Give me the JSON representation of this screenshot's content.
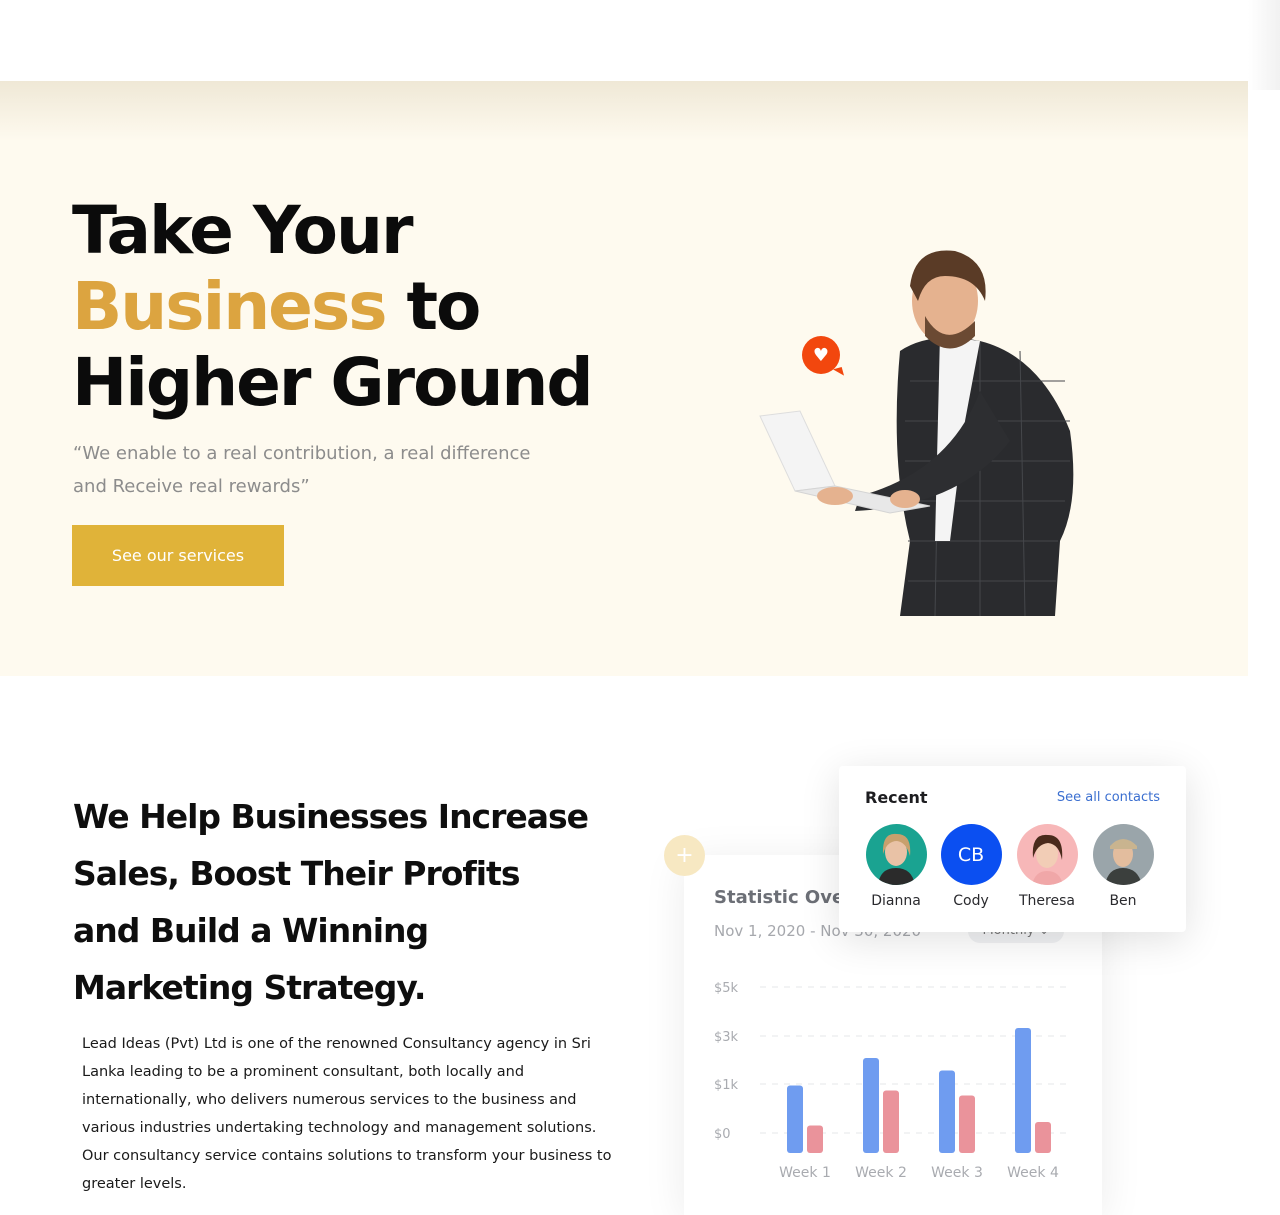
{
  "hero": {
    "title_line1": "Take Your",
    "title_accent": "Business",
    "title_to": " to",
    "title_line3": "Higher Ground",
    "quote": "“We enable to a real contribution, a real difference and Receive real rewards”",
    "cta_label": "See our services",
    "accent_color": "#dca440",
    "button_color": "#e0b339",
    "background": "#fefaef"
  },
  "about": {
    "heading": "We Help Businesses Increase Sales, Boost Their Profits and Build a Winning Marketing Strategy.",
    "body": "Lead Ideas (Pvt) Ltd is one of the renowned Consultancy agency in Sri Lanka leading to be a prominent consultant, both locally and internationally, who delivers numerous services to the business and various industries undertaking technology and management solutions. Our consultancy service contains solutions to transform your business to greater levels."
  },
  "stat_card": {
    "title": "Statistic Ove",
    "date_range": "Nov 1, 2020 - Nov 30, 2020",
    "period_select": "Monthly ⌄",
    "plus_icon": "+"
  },
  "recent": {
    "title": "Recent",
    "link_label": "See all contacts",
    "contacts": [
      {
        "name": "Dianna",
        "initials": "",
        "color": "#1aa391"
      },
      {
        "name": "Cody",
        "initials": "CB",
        "color": "#0b4ff1"
      },
      {
        "name": "Theresa",
        "initials": "",
        "color": "#f7b7b8"
      },
      {
        "name": "Ben",
        "initials": "",
        "color": "#9aa5aa"
      }
    ]
  },
  "chart_data": {
    "type": "bar",
    "categories": [
      "Week 1",
      "Week 2",
      "Week 3",
      "Week 4"
    ],
    "ytick_labels": [
      "$5k",
      "$3k",
      "$1k",
      "$0"
    ],
    "series": [
      {
        "color": "#6f9cf0",
        "values": [
          1.35,
          1.9,
          1.65,
          2.5
        ]
      },
      {
        "color": "#ea939b",
        "values": [
          0.55,
          1.25,
          1.15,
          0.62
        ]
      }
    ]
  }
}
